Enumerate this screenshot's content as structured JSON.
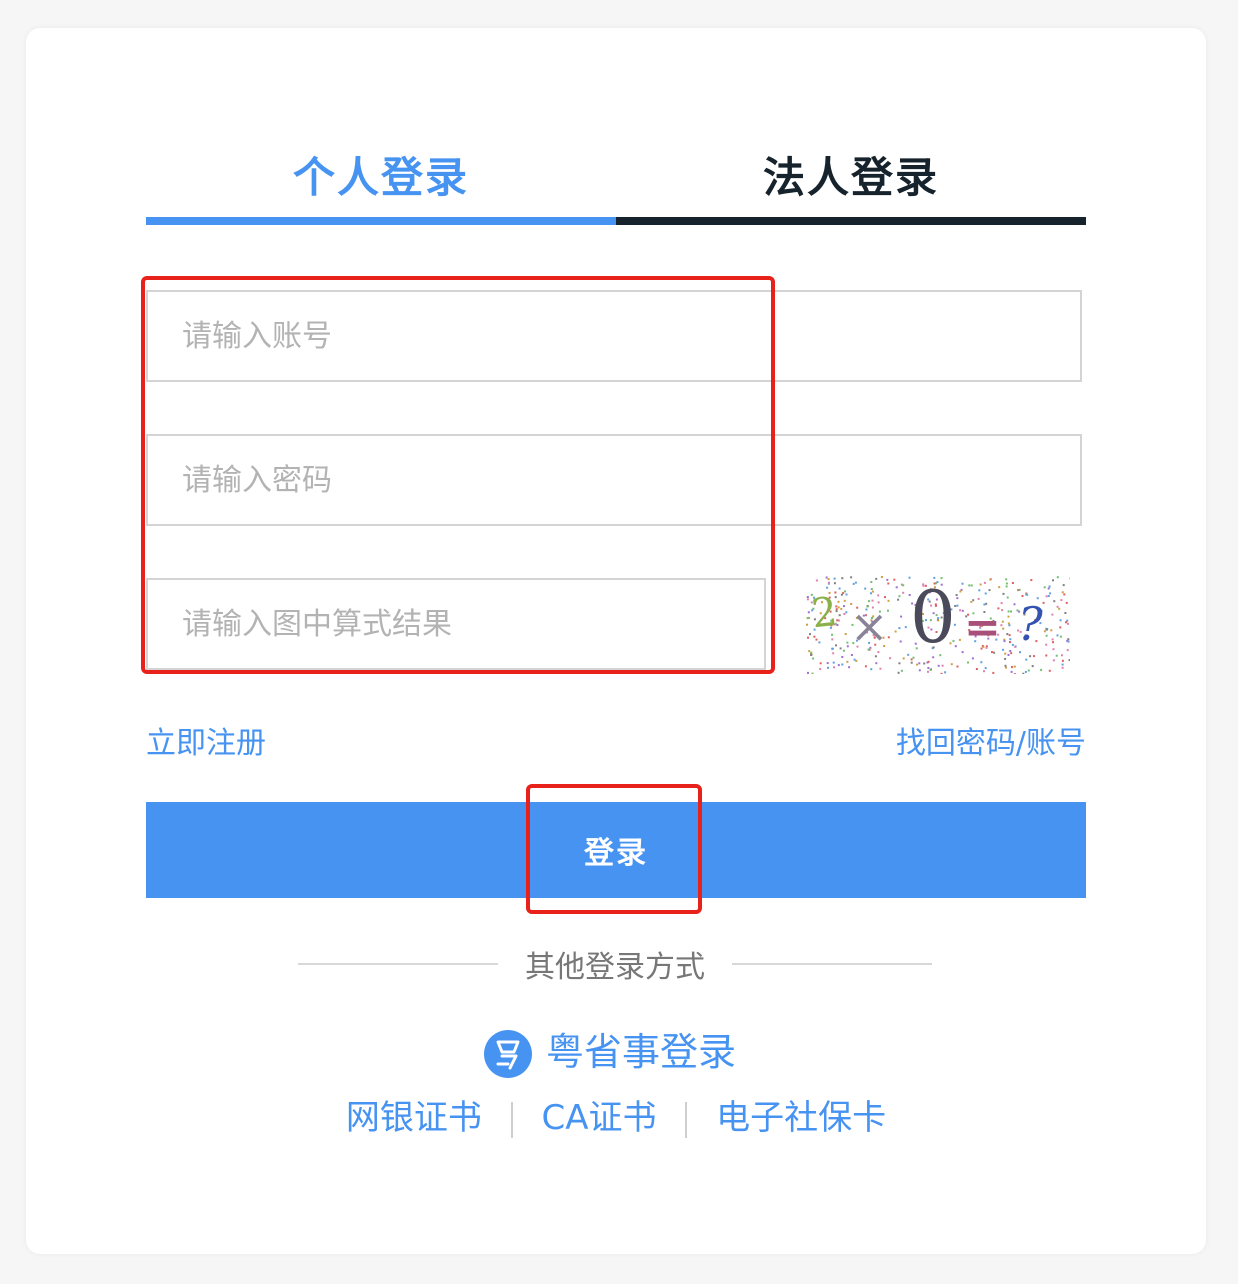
{
  "colors": {
    "accent": "#4793f1",
    "dark": "#16232c",
    "highlight": "#e8221b"
  },
  "tabs": {
    "personal": "个人登录",
    "legal": "法人登录",
    "active": "personal"
  },
  "form": {
    "account_placeholder": "请输入账号",
    "password_placeholder": "请输入密码",
    "captcha_placeholder": "请输入图中算式结果"
  },
  "captcha": {
    "expression": [
      "2",
      "×",
      "0",
      "=",
      "?"
    ],
    "icon": "captcha-image"
  },
  "links": {
    "register": "立即注册",
    "recover": "找回密码/账号"
  },
  "login_button": "登录",
  "other": {
    "divider_label": "其他登录方式",
    "yss_label": "粤省事登录",
    "yss_icon": "yueshengshi-logo-icon",
    "methods": [
      "网银证书",
      "CA证书",
      "电子社保卡"
    ]
  }
}
